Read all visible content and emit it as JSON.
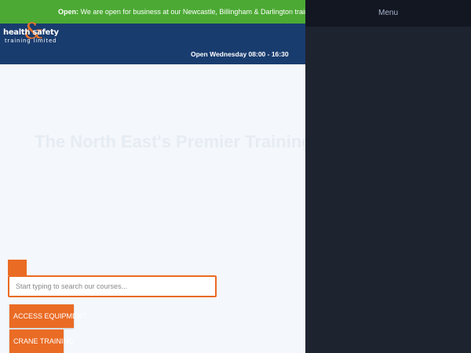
{
  "topbar": {
    "open_label": "Open:",
    "message": " We are open for business at our Newcastle, Billingham & Darlington training centr"
  },
  "header": {
    "logo": {
      "line1": "health safety",
      "ampersand": "&",
      "line2": "training limited"
    },
    "hours": "Open Wednesday 08:00 - 16:30"
  },
  "hero": {
    "title": "The North East's Premier Training Pr",
    "faint_items": [
      "",
      "",
      "",
      "",
      ""
    ]
  },
  "search": {
    "placeholder": "Start typing to search our courses..."
  },
  "categories": [
    {
      "label": "ACCESS EQUIPMENT"
    },
    {
      "label": "CRANE TRAINING"
    }
  ],
  "menu": {
    "label": "Menu"
  },
  "colors": {
    "topbar_green": "#4aa832",
    "header_navy": "#173a6e",
    "accent_orange": "#ea6a22",
    "menu_dark": "#1e2330"
  }
}
